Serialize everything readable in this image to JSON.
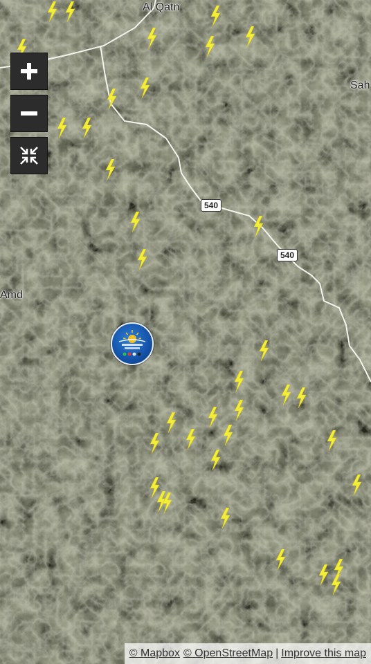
{
  "map": {
    "places": [
      {
        "name": "place-al-qathn",
        "label": "Al Qatn"
      },
      {
        "name": "place-sah",
        "label": "Sah"
      },
      {
        "name": "place-amd",
        "label": "Amd"
      }
    ],
    "road_shields": [
      {
        "name": "road-shield-540-a",
        "label": "540"
      },
      {
        "name": "road-shield-540-b",
        "label": "540"
      }
    ],
    "lightning_strike_icon": "lightning-bolt-icon",
    "lightning_color": "#f2ee3a",
    "station_logo_icon": "weather-station-logo-icon"
  },
  "controls": {
    "zoom_in": "zoom-in-icon",
    "zoom_out": "zoom-out-icon",
    "fullscreen_exit": "exit-fullscreen-icon"
  },
  "attribution": {
    "mapbox": "© Mapbox",
    "osm": "© OpenStreetMap",
    "separator": "|",
    "improve": "Improve this map"
  }
}
